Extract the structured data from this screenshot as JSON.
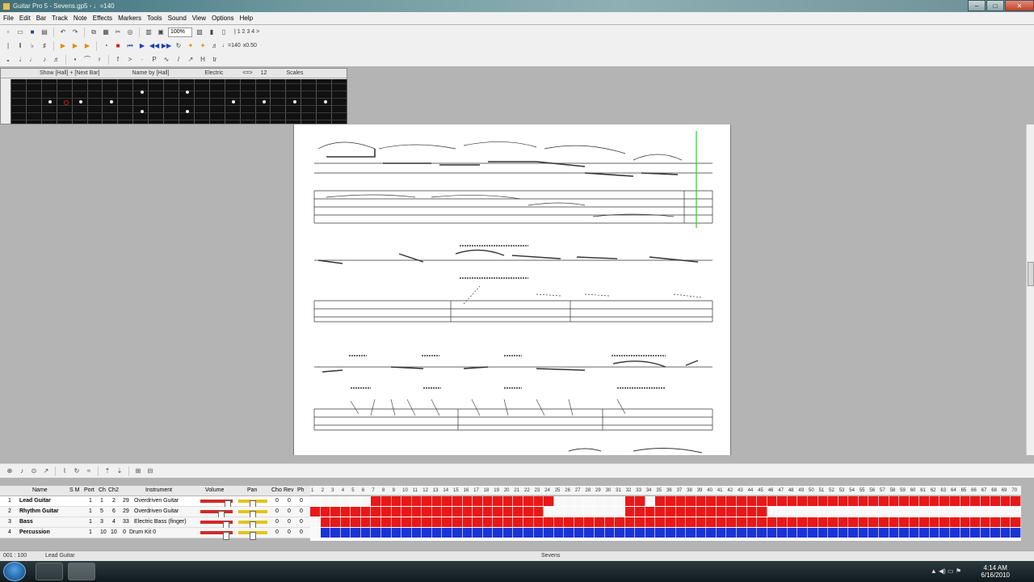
{
  "window": {
    "title": "Guitar Pro 5 - Sevens.gp5 - ♩=140",
    "minimize": "–",
    "maximize": "□",
    "close": "✕"
  },
  "menu": [
    "File",
    "Edit",
    "Bar",
    "Track",
    "Note",
    "Effects",
    "Markers",
    "Tools",
    "Sound",
    "View",
    "Options",
    "Help"
  ],
  "toolbar": {
    "zoom": "100%",
    "pages": "| 1 2 3 4 >",
    "speed": "x0.50",
    "tempo": "♩=140"
  },
  "fretboard": {
    "show": "Show [Hall] + [Next Bar]",
    "name": "Name by [Hall]",
    "instrument": "Electric",
    "octave": "<=>",
    "fret": "12",
    "scales": "Scales",
    "dots": [
      {
        "fret": 3,
        "string": 2
      },
      {
        "fret": 4,
        "string": 2,
        "style": "red"
      },
      {
        "fret": 5,
        "string": 2
      },
      {
        "fret": 7,
        "string": 2
      },
      {
        "fret": 9,
        "string": 1
      },
      {
        "fret": 9,
        "string": 3
      },
      {
        "fret": 12,
        "string": 1
      },
      {
        "fret": 12,
        "string": 3
      },
      {
        "fret": 15,
        "string": 2
      },
      {
        "fret": 17,
        "string": 2
      },
      {
        "fret": 19,
        "string": 2
      },
      {
        "fret": 21,
        "string": 2
      }
    ]
  },
  "tracks": {
    "header": {
      "name": "Name",
      "sm": "S M",
      "port": "Port",
      "ch": "Ch",
      "ch2": "Ch2",
      "instrument": "Instrument",
      "volume": "Volume",
      "pan": "Pan",
      "cho": "Cho",
      "rev": "Rev",
      "ph": "Ph"
    },
    "rows": [
      {
        "num": "1",
        "name": "Lead Guitar",
        "port": "1",
        "ch": "1",
        "ch2": "2",
        "prog": "29",
        "instrument": "Overdriven Guitar",
        "cho": "0",
        "rev": "0",
        "ph": "0"
      },
      {
        "num": "2",
        "name": "Rhythm Guitar",
        "port": "1",
        "ch": "5",
        "ch2": "6",
        "prog": "29",
        "instrument": "Overdriven Guitar",
        "cho": "0",
        "rev": "0",
        "ph": "0"
      },
      {
        "num": "3",
        "name": "Bass",
        "port": "1",
        "ch": "3",
        "ch2": "4",
        "prog": "33",
        "instrument": "Electric Bass (finger)",
        "cho": "0",
        "rev": "0",
        "ph": "0"
      },
      {
        "num": "4",
        "name": "Percussion",
        "port": "1",
        "ch": "10",
        "ch2": "10",
        "prog": "0",
        "instrument": "Drum Kit 0",
        "cho": "0",
        "rev": "0",
        "ph": "0"
      }
    ],
    "bar_colors": {
      "filled": "#e81818",
      "empty": "#f8f8f8",
      "drums": "#1a33d6"
    }
  },
  "status": {
    "position": "001 : 100",
    "track": "Lead Guitar",
    "song": "Sevens"
  },
  "taskbar": {
    "time": "4:14 AM",
    "date": "6/16/2010"
  }
}
